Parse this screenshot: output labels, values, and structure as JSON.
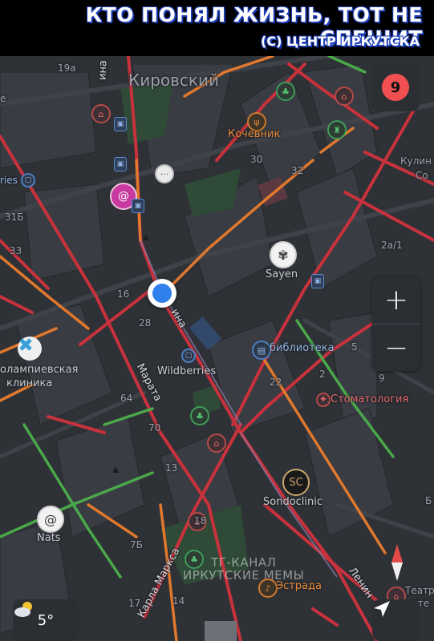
{
  "banner": {
    "title": "КТО ПОНЯЛ ЖИЗНЬ, ТОТ НЕ СПЕШИТ",
    "subtitle": "(С) ЦЕНТР ИРКУТСКА"
  },
  "map": {
    "theme": "dark",
    "district": "Кировский",
    "traffic_level": "9",
    "traffic_color": "#f25050",
    "weather": {
      "icon": "sun-cloud-icon",
      "temperature": "5°"
    },
    "house_numbers": [
      "19а",
      "30",
      "32",
      "31Б",
      "33",
      "16",
      "28",
      "2а/1",
      "22",
      "2",
      "5",
      "9",
      "64",
      "70",
      "13",
      "18",
      "7Б",
      "14",
      "17"
    ],
    "streets": [
      "ина",
      "ина",
      "Марата",
      "Карла Маркса",
      "Ленин"
    ],
    "partial_labels": [
      "е",
      "ries",
      "Кулин",
      "Со",
      "олампиевская",
      "клиника",
      "Б",
      "Театр",
      "ите"
    ],
    "pois": [
      {
        "name": "Кочевник",
        "icon": "fork-knife-icon"
      },
      {
        "name": "Sayen",
        "icon": "mandala-logo-icon"
      },
      {
        "name": "библиотека",
        "icon": "book-icon"
      },
      {
        "name": "Wildberries",
        "icon": "shop-icon"
      },
      {
        "name": "Стоматология",
        "icon": "tooth-icon"
      },
      {
        "name": "Sondoclinic",
        "icon": "sc-logo-icon"
      },
      {
        "name": "Nats",
        "icon": "nats-logo-icon"
      },
      {
        "name": "Эстрада",
        "icon": "music-icon"
      }
    ],
    "watermark": [
      "ТГ-КАНАЛ",
      "ИРКУТСКИЕ МЕМЫ"
    ],
    "traffic_colors": {
      "jam": "#c8323c",
      "slow": "#e0782d",
      "free": "#4aa84a"
    }
  }
}
